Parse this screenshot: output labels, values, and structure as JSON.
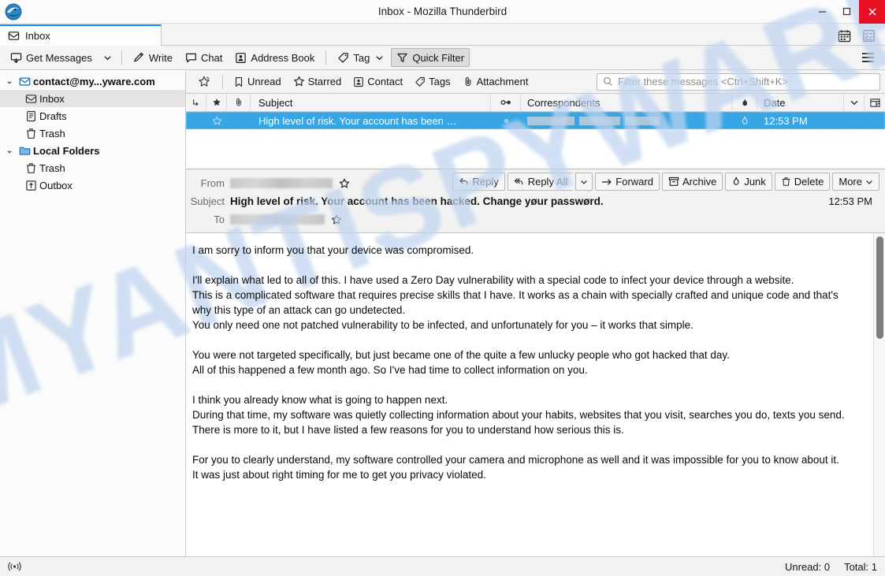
{
  "window": {
    "title": "Inbox - Mozilla Thunderbird",
    "minimize_label": "—",
    "maximize_label": "□",
    "close_label": "✕",
    "close_color": "#e81123"
  },
  "tabbar": {
    "tabs": [
      {
        "label": "Inbox",
        "icon": "inbox-icon",
        "active": true
      }
    ],
    "calendar_icon": "calendar-icon",
    "tasks_icon": "tasks-icon"
  },
  "toolbar": {
    "get_messages": "Get Messages",
    "write": "Write",
    "chat": "Chat",
    "address_book": "Address Book",
    "tag": "Tag",
    "quick_filter": "Quick Filter",
    "menu_icon": "hamburger-menu-icon"
  },
  "folderpane": {
    "items": [
      {
        "label": "contact@my...yware.com",
        "icon": "account-mail-icon",
        "level": 0,
        "twisty": "⌄",
        "bold": true,
        "selected": false
      },
      {
        "label": "Inbox",
        "icon": "inbox-icon",
        "level": 1,
        "twisty": "",
        "bold": false,
        "selected": true
      },
      {
        "label": "Drafts",
        "icon": "drafts-icon",
        "level": 1,
        "twisty": "",
        "bold": false,
        "selected": false
      },
      {
        "label": "Trash",
        "icon": "trash-icon",
        "level": 1,
        "twisty": "",
        "bold": false,
        "selected": false
      },
      {
        "label": "Local Folders",
        "icon": "folder-icon",
        "level": 0,
        "twisty": "⌄",
        "bold": true,
        "selected": false
      },
      {
        "label": "Trash",
        "icon": "trash-icon",
        "level": 1,
        "twisty": "",
        "bold": false,
        "selected": false
      },
      {
        "label": "Outbox",
        "icon": "outbox-icon",
        "level": 1,
        "twisty": "",
        "bold": false,
        "selected": false
      }
    ]
  },
  "quickfilter": {
    "pin_icon": "pin-filter-icon",
    "buttons": [
      {
        "label": "Unread",
        "icon": "unread-icon"
      },
      {
        "label": "Starred",
        "icon": "star-icon"
      },
      {
        "label": "Contact",
        "icon": "contact-icon"
      },
      {
        "label": "Tags",
        "icon": "tag-icon"
      },
      {
        "label": "Attachment",
        "icon": "attachment-icon"
      }
    ],
    "search_placeholder": "Filter these messages <Ctrl+Shift+K>",
    "search_value": "",
    "search_icon": "search-icon"
  },
  "threadpane": {
    "columns": [
      {
        "key": "thread",
        "label": "",
        "icon": "thread-icon"
      },
      {
        "key": "star",
        "label": "",
        "icon": "star-icon"
      },
      {
        "key": "attachment",
        "label": "",
        "icon": "attachment-icon"
      },
      {
        "key": "subject",
        "label": "Subject",
        "icon": ""
      },
      {
        "key": "unread",
        "label": "",
        "icon": "unread-dot-icon"
      },
      {
        "key": "correspondents",
        "label": "Correspondents",
        "icon": ""
      },
      {
        "key": "junk",
        "label": "",
        "icon": "junk-flame-icon"
      },
      {
        "key": "date",
        "label": "Date",
        "icon": ""
      },
      {
        "key": "sort",
        "label": "",
        "icon": "chevron-down-icon"
      },
      {
        "key": "colpicker",
        "label": "",
        "icon": "column-picker-icon"
      }
    ],
    "rows": [
      {
        "subject": "High level of risk. Your account has been …",
        "correspondents": "",
        "correspondents_redacted": true,
        "date": "12:53 PM",
        "selected": true,
        "starred": false,
        "unread_dot": true
      }
    ],
    "selection_color": "#38a5e4"
  },
  "message": {
    "from_label": "From",
    "from_value": "",
    "from_redacted": true,
    "subject_label": "Subject",
    "subject_value": "High level of risk. Your account has been hacked. Change yøur passwørd.",
    "to_label": "To",
    "to_value": "",
    "to_redacted": true,
    "time": "12:53 PM",
    "star_icon": "star-outline-icon",
    "actions": [
      {
        "label": "Reply",
        "icon": "reply-icon",
        "has_arrow": false
      },
      {
        "label": "Reply All",
        "icon": "reply-all-icon",
        "has_arrow": true
      },
      {
        "label": "Forward",
        "icon": "forward-arrow-icon",
        "has_arrow": false
      },
      {
        "label": "Archive",
        "icon": "archive-box-icon",
        "has_arrow": false
      },
      {
        "label": "Junk",
        "icon": "junk-flame-icon",
        "has_arrow": false
      },
      {
        "label": "Delete",
        "icon": "trash-icon",
        "has_arrow": false
      },
      {
        "label": "More",
        "icon": "",
        "has_arrow": true
      }
    ],
    "body_paragraphs": [
      "I am sorry to inform you that your device was compromised.",
      "I'll explain what led to all of this. I have used a Zero Day vulnerability with a special code to infect your device through a website.\nThis is a complicated software that requires precise skills that I have. It works as a chain with specially crafted and unique code and that's why this type of an attack can go undetected.\nYou only need one not patched vulnerability to be infected, and unfortunately for you – it works that simple.",
      "You were not targeted specifically, but just became one of the quite a few unlucky people who got hacked that day.\nAll of this happened a few month ago. So I've had time to collect information on you.",
      "I think you already know what is going to happen next.\nDuring that time, my software was quietly collecting information about your habits, websites that you visit, searches you do, texts you send.\nThere is more to it, but I have listed a few reasons for you to understand how serious this is.",
      "For you to clearly understand, my software controlled your camera and microphone as well and it was impossible for you to know about it.\nIt was just about right timing for me to get you privacy violated."
    ]
  },
  "watermark": {
    "text": "MYANTISPYWARE.COM",
    "color": "#bfd4ef"
  },
  "statusbar": {
    "connection_icon": "connection-icon",
    "unread": "Unread: 0",
    "total": "Total: 1"
  }
}
